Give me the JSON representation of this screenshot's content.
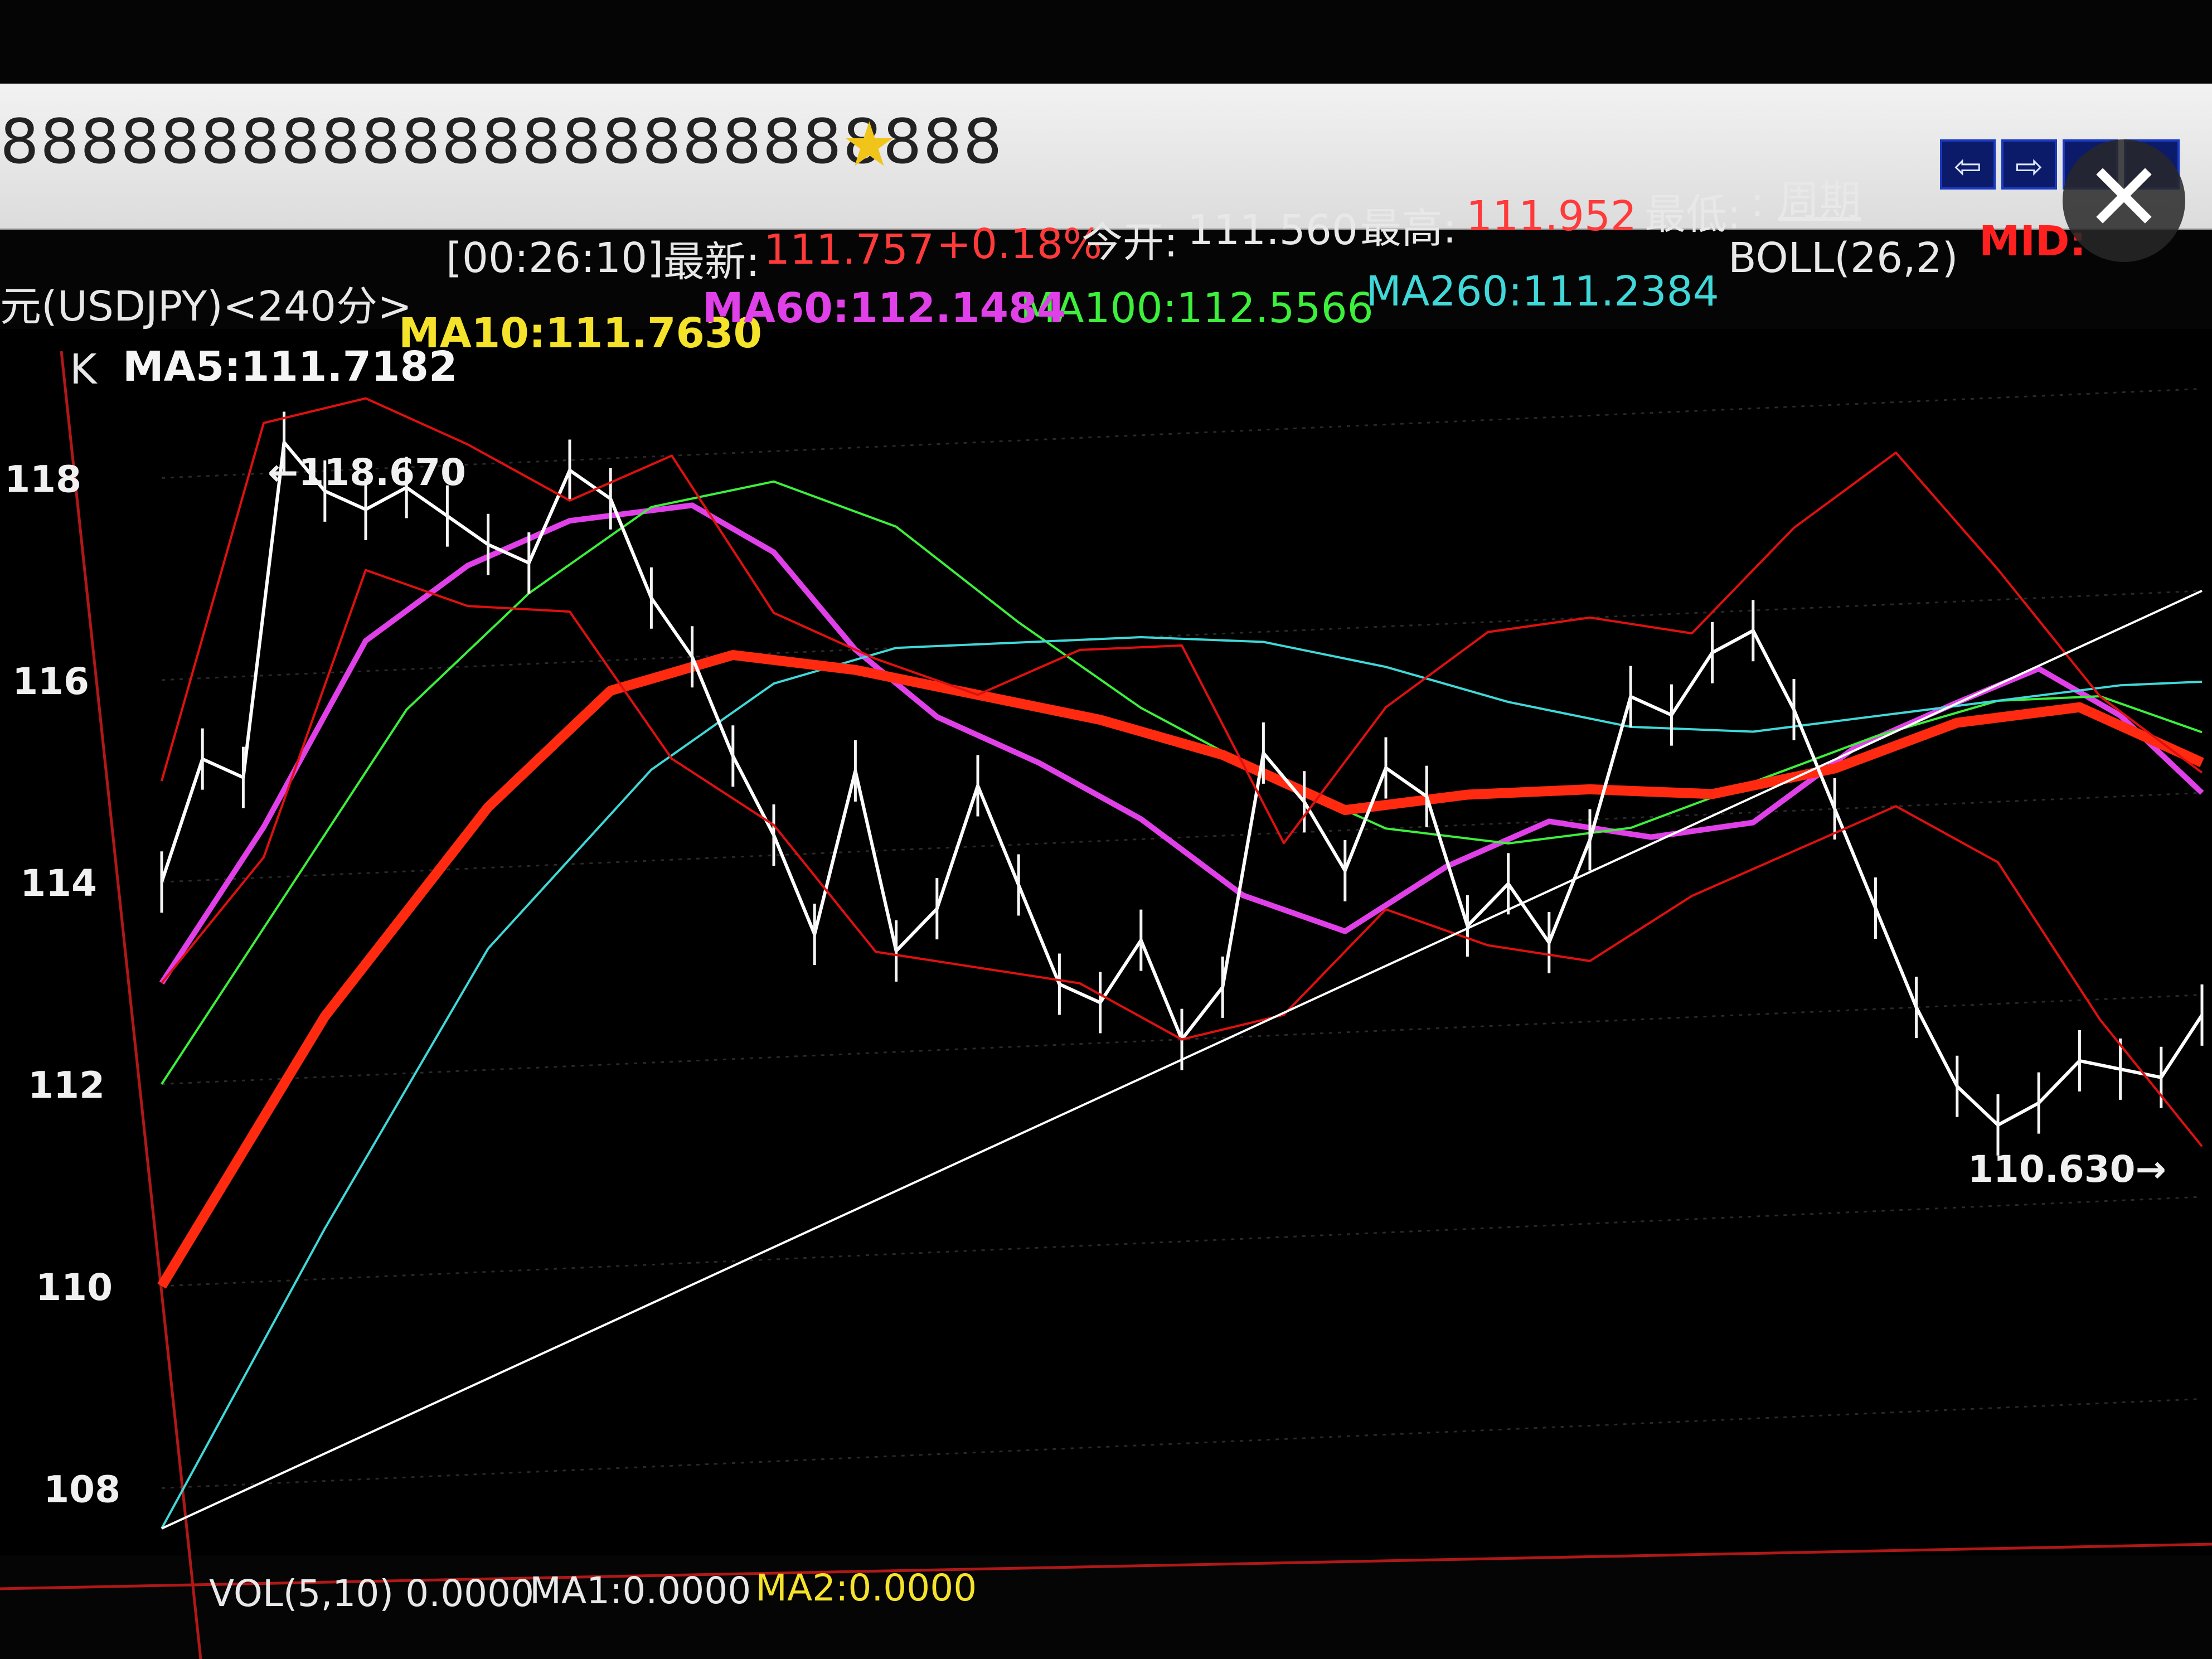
{
  "window": {
    "title": "8888888888888888888888888",
    "star_icon": "star-icon",
    "close_icon": "close-icon"
  },
  "quote_bar": {
    "symbol_label": "元(USDJPY)<240分>",
    "time": "[00:26:10]",
    "latest_label": "最新:",
    "latest_value": "111.757",
    "change_pct": "+0.18%",
    "open_label": "今开:",
    "open_value": "111.560",
    "high_label": "最高:",
    "high_value": "111.952",
    "low_label": "最低:",
    "low_value": ":",
    "period_link": "周期",
    "nav_buttons": [
      "⇦",
      "⇨",
      "",
      ""
    ]
  },
  "indicators": {
    "k_label": "K",
    "ma5": "MA5:111.7182",
    "ma10": "MA10:111.7630",
    "ma60": "MA60:112.1484",
    "ma100": "MA100:112.5566",
    "ma260": "MA260:111.2384",
    "boll": "BOLL(26,2)",
    "mid": "MID:"
  },
  "volume_bar": {
    "vol": "VOL(5,10) 0.0000",
    "ma1": "MA1:0.0000",
    "ma2": "MA2:0.0000"
  },
  "chart_data": {
    "type": "line",
    "yaxis_ticks": [
      118,
      116,
      114,
      112,
      110,
      108
    ],
    "ylim": [
      107.5,
      119.2
    ],
    "annotations": [
      "118.670",
      "110.630"
    ],
    "colors": {
      "price": "#ffffff",
      "ma5": "#ffffff",
      "ma10": "#f5e22a",
      "ma60": "#e040e8",
      "ma100": "#3cf03c",
      "ma260": "#40d8d8",
      "boll": "#e01010",
      "mid": "#ff2a10",
      "trend": "#ffffff"
    },
    "series": [
      {
        "name": "MA60",
        "x": [
          0,
          0.05,
          0.1,
          0.15,
          0.2,
          0.26,
          0.3,
          0.34,
          0.38,
          0.43,
          0.48,
          0.53,
          0.58,
          0.63,
          0.68,
          0.73,
          0.78,
          0.83,
          0.88,
          0.92,
          0.96,
          1.0
        ],
        "values": [
          113.0,
          114.5,
          116.3,
          117.0,
          117.4,
          117.5,
          117.0,
          116.0,
          115.3,
          114.8,
          114.2,
          113.4,
          113.0,
          113.6,
          114.0,
          113.8,
          113.9,
          114.6,
          115.0,
          115.3,
          114.8,
          114.0
        ]
      },
      {
        "name": "MA100",
        "x": [
          0,
          0.06,
          0.12,
          0.18,
          0.24,
          0.3,
          0.36,
          0.42,
          0.48,
          0.54,
          0.6,
          0.66,
          0.72,
          0.78,
          0.84,
          0.9,
          0.95,
          1.0
        ],
        "values": [
          112.0,
          113.8,
          115.6,
          116.7,
          117.5,
          117.7,
          117.2,
          116.2,
          115.3,
          114.6,
          114.0,
          113.8,
          113.9,
          114.3,
          114.7,
          115.0,
          115.0,
          114.6
        ]
      },
      {
        "name": "MA260",
        "x": [
          0,
          0.08,
          0.16,
          0.24,
          0.3,
          0.36,
          0.42,
          0.48,
          0.54,
          0.6,
          0.66,
          0.72,
          0.78,
          0.84,
          0.9,
          0.96,
          1.0
        ],
        "values": [
          107.6,
          110.5,
          113.2,
          114.9,
          115.7,
          116.0,
          116.0,
          116.0,
          115.9,
          115.6,
          115.2,
          114.9,
          114.8,
          114.9,
          115.0,
          115.1,
          115.1
        ]
      },
      {
        "name": "MID",
        "x": [
          0,
          0.08,
          0.16,
          0.22,
          0.28,
          0.34,
          0.4,
          0.46,
          0.52,
          0.58,
          0.64,
          0.7,
          0.76,
          0.82,
          0.88,
          0.94,
          1.0
        ],
        "values": [
          110.0,
          112.6,
          114.6,
          115.7,
          116.0,
          115.8,
          115.5,
          115.2,
          114.8,
          114.2,
          114.3,
          114.3,
          114.2,
          114.4,
          114.8,
          114.9,
          114.3
        ]
      },
      {
        "name": "Price",
        "x": [
          0,
          0.02,
          0.04,
          0.06,
          0.08,
          0.1,
          0.12,
          0.14,
          0.16,
          0.18,
          0.2,
          0.22,
          0.24,
          0.26,
          0.28,
          0.3,
          0.32,
          0.34,
          0.36,
          0.38,
          0.4,
          0.42,
          0.44,
          0.46,
          0.48,
          0.5,
          0.52,
          0.54,
          0.56,
          0.58,
          0.6,
          0.62,
          0.64,
          0.66,
          0.68,
          0.7,
          0.72,
          0.74,
          0.76,
          0.78,
          0.8,
          0.82,
          0.84,
          0.86,
          0.88,
          0.9,
          0.92,
          0.94,
          0.96,
          0.98,
          1.0
        ],
        "values": [
          114.0,
          115.2,
          115.0,
          118.3,
          117.8,
          117.6,
          117.8,
          117.5,
          117.2,
          117.0,
          117.9,
          117.6,
          116.6,
          116.0,
          115.0,
          114.2,
          113.2,
          114.8,
          113.0,
          113.4,
          114.6,
          113.6,
          112.6,
          112.4,
          113.0,
          112.0,
          112.5,
          114.8,
          114.3,
          113.6,
          114.6,
          114.3,
          113.0,
          113.4,
          112.8,
          113.8,
          115.2,
          115.0,
          115.6,
          115.8,
          115.0,
          114.0,
          113.0,
          112.0,
          111.2,
          110.8,
          111.0,
          111.4,
          111.3,
          111.2,
          111.8
        ]
      },
      {
        "name": "BOLL-UPPER",
        "x": [
          0,
          0.05,
          0.1,
          0.15,
          0.2,
          0.25,
          0.3,
          0.35,
          0.4,
          0.45,
          0.5,
          0.55,
          0.6,
          0.65,
          0.7,
          0.75,
          0.8,
          0.85,
          0.9,
          0.95,
          1.0
        ],
        "values": [
          115.0,
          118.5,
          118.7,
          118.2,
          117.6,
          118.0,
          116.4,
          115.9,
          115.5,
          115.9,
          115.9,
          113.9,
          115.2,
          115.9,
          116.0,
          115.8,
          116.8,
          117.5,
          116.3,
          115.0,
          114.2
        ]
      },
      {
        "name": "BOLL-LOWER",
        "x": [
          0,
          0.05,
          0.1,
          0.15,
          0.2,
          0.25,
          0.3,
          0.35,
          0.4,
          0.45,
          0.5,
          0.55,
          0.6,
          0.65,
          0.7,
          0.75,
          0.8,
          0.85,
          0.9,
          0.95,
          1.0
        ],
        "values": [
          113.0,
          114.2,
          117.0,
          116.6,
          116.5,
          115.0,
          114.3,
          113.0,
          112.8,
          112.6,
          112.0,
          112.2,
          113.2,
          112.8,
          112.6,
          113.2,
          113.6,
          114.0,
          113.4,
          111.8,
          110.5
        ]
      },
      {
        "name": "TREND",
        "x": [
          0.0,
          1.0
        ],
        "values": [
          107.6,
          116.0
        ]
      }
    ]
  }
}
